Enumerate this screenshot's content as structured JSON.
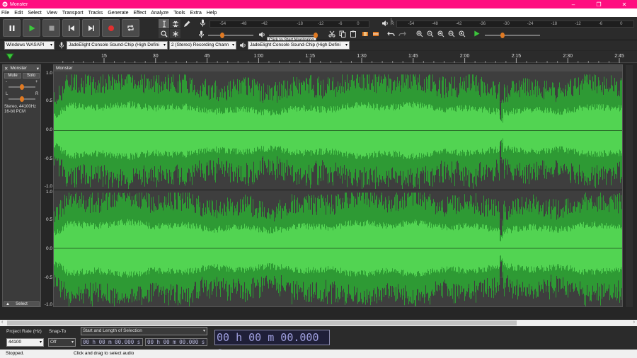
{
  "window": {
    "title": "Monster",
    "controls": [
      "–",
      "❐",
      "✕"
    ]
  },
  "menu": [
    "File",
    "Edit",
    "Select",
    "View",
    "Transport",
    "Tracks",
    "Generate",
    "Effect",
    "Analyze",
    "Tools",
    "Extra",
    "Help"
  ],
  "meters": {
    "record_scale": [
      "-54",
      "-48",
      "-42",
      "",
      "-18",
      "-12",
      "-6",
      "0"
    ],
    "monitor_hint": "Click to Start Monitoring",
    "play_scale": [
      "-54",
      "-48",
      "-42",
      "-36",
      "-30",
      "-24",
      "-18",
      "-12",
      "-6",
      "0"
    ],
    "lr_label": "L R"
  },
  "device": {
    "host": "Windows WASAPI",
    "recording_device": "JadeElight Console Sound-Chip (High Defini",
    "channels": "2 (Stereo) Recording Chann",
    "playback_device": "JadeElight Console Sound-Chip (High Defini"
  },
  "timeline": {
    "ticks": [
      "15",
      "30",
      "45",
      "1:00",
      "1:15",
      "1:30",
      "1:45",
      "2:00",
      "2:15",
      "2:30",
      "2:45"
    ]
  },
  "track": {
    "name": "Monster",
    "mute_label": "Mute",
    "solo_label": "Solo",
    "gain_minus": "-",
    "gain_plus": "+",
    "pan_left": "L",
    "pan_right": "R",
    "info_line1": "Stereo, 44100Hz",
    "info_line2": "16-bit PCM",
    "select_label": "Select",
    "clip_name": "Monster",
    "scale": [
      "1.0",
      "0.5",
      "0.0",
      "-0.5",
      "-1.0"
    ]
  },
  "selection": {
    "project_rate_label": "Project Rate (Hz)",
    "project_rate_value": "44100",
    "snap_label": "Snap-To",
    "snap_value": "Off",
    "selection_mode": "Start and Length of Selection",
    "start_time": "00 h 00 m 00.000 s",
    "length_time": "00 h 00 m 00.000 s",
    "audio_position": "00 h 00 m 00.000 s"
  },
  "status": {
    "state": "Stopped.",
    "hint": "Click and drag to select audio"
  },
  "colors": {
    "titlebar": "#ff0d80",
    "wave_peak": "#2e9a34",
    "wave_rms": "#52d452",
    "record": "#e03030"
  }
}
